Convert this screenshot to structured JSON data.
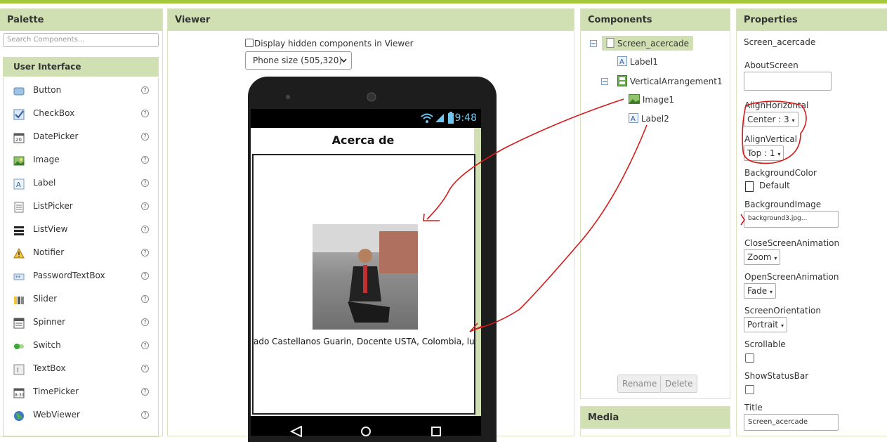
{
  "palette": {
    "title": "Palette",
    "search_placeholder": "Search Components...",
    "category": "User Interface",
    "help_glyph": "?",
    "items": [
      {
        "label": "Button",
        "icon": "button-icon"
      },
      {
        "label": "CheckBox",
        "icon": "checkbox-icon"
      },
      {
        "label": "DatePicker",
        "icon": "datepicker-icon"
      },
      {
        "label": "Image",
        "icon": "image-icon"
      },
      {
        "label": "Label",
        "icon": "label-icon"
      },
      {
        "label": "ListPicker",
        "icon": "listpicker-icon"
      },
      {
        "label": "ListView",
        "icon": "listview-icon"
      },
      {
        "label": "Notifier",
        "icon": "notifier-icon"
      },
      {
        "label": "PasswordTextBox",
        "icon": "password-icon"
      },
      {
        "label": "Slider",
        "icon": "slider-icon"
      },
      {
        "label": "Spinner",
        "icon": "spinner-icon"
      },
      {
        "label": "Switch",
        "icon": "switch-icon"
      },
      {
        "label": "TextBox",
        "icon": "textbox-icon"
      },
      {
        "label": "TimePicker",
        "icon": "timepicker-icon"
      },
      {
        "label": "WebViewer",
        "icon": "webviewer-icon"
      }
    ]
  },
  "viewer": {
    "title": "Viewer",
    "display_hidden_label": "Display hidden components in Viewer",
    "phone_size": "Phone size (505,320)",
    "status_time": "9:48",
    "screen_title": "Acerca de",
    "label2_text": "ado Castellanos Guarin, Docente USTA, Colombia, luis.castellanos"
  },
  "components": {
    "title": "Components",
    "tree": {
      "screen": "Screen_acercade",
      "label1": "Label1",
      "varr": "VerticalArrangement1",
      "image1": "Image1",
      "label2": "Label2"
    },
    "rename_label": "Rename",
    "delete_label": "Delete",
    "media_title": "Media"
  },
  "properties": {
    "title": "Properties",
    "component": "Screen_acercade",
    "about_screen_label": "AboutScreen",
    "align_horizontal_label": "AlignHorizontal",
    "align_horizontal_value": "Center : 3",
    "align_vertical_label": "AlignVertical",
    "align_vertical_value": "Top : 1",
    "background_color_label": "BackgroundColor",
    "background_color_value": "Default",
    "background_image_label": "BackgroundImage",
    "background_image_value": "background3.jpg...",
    "close_anim_label": "CloseScreenAnimation",
    "close_anim_value": "Zoom",
    "open_anim_label": "OpenScreenAnimation",
    "open_anim_value": "Fade",
    "orientation_label": "ScreenOrientation",
    "orientation_value": "Portrait",
    "scrollable_label": "Scrollable",
    "show_status_label": "ShowStatusBar",
    "title_label": "Title",
    "title_value": "Screen_acercade"
  },
  "colors": {
    "accent_green": "#a5c83c",
    "header_green": "#d0e0b3",
    "annotation_red": "#d61a1a"
  }
}
